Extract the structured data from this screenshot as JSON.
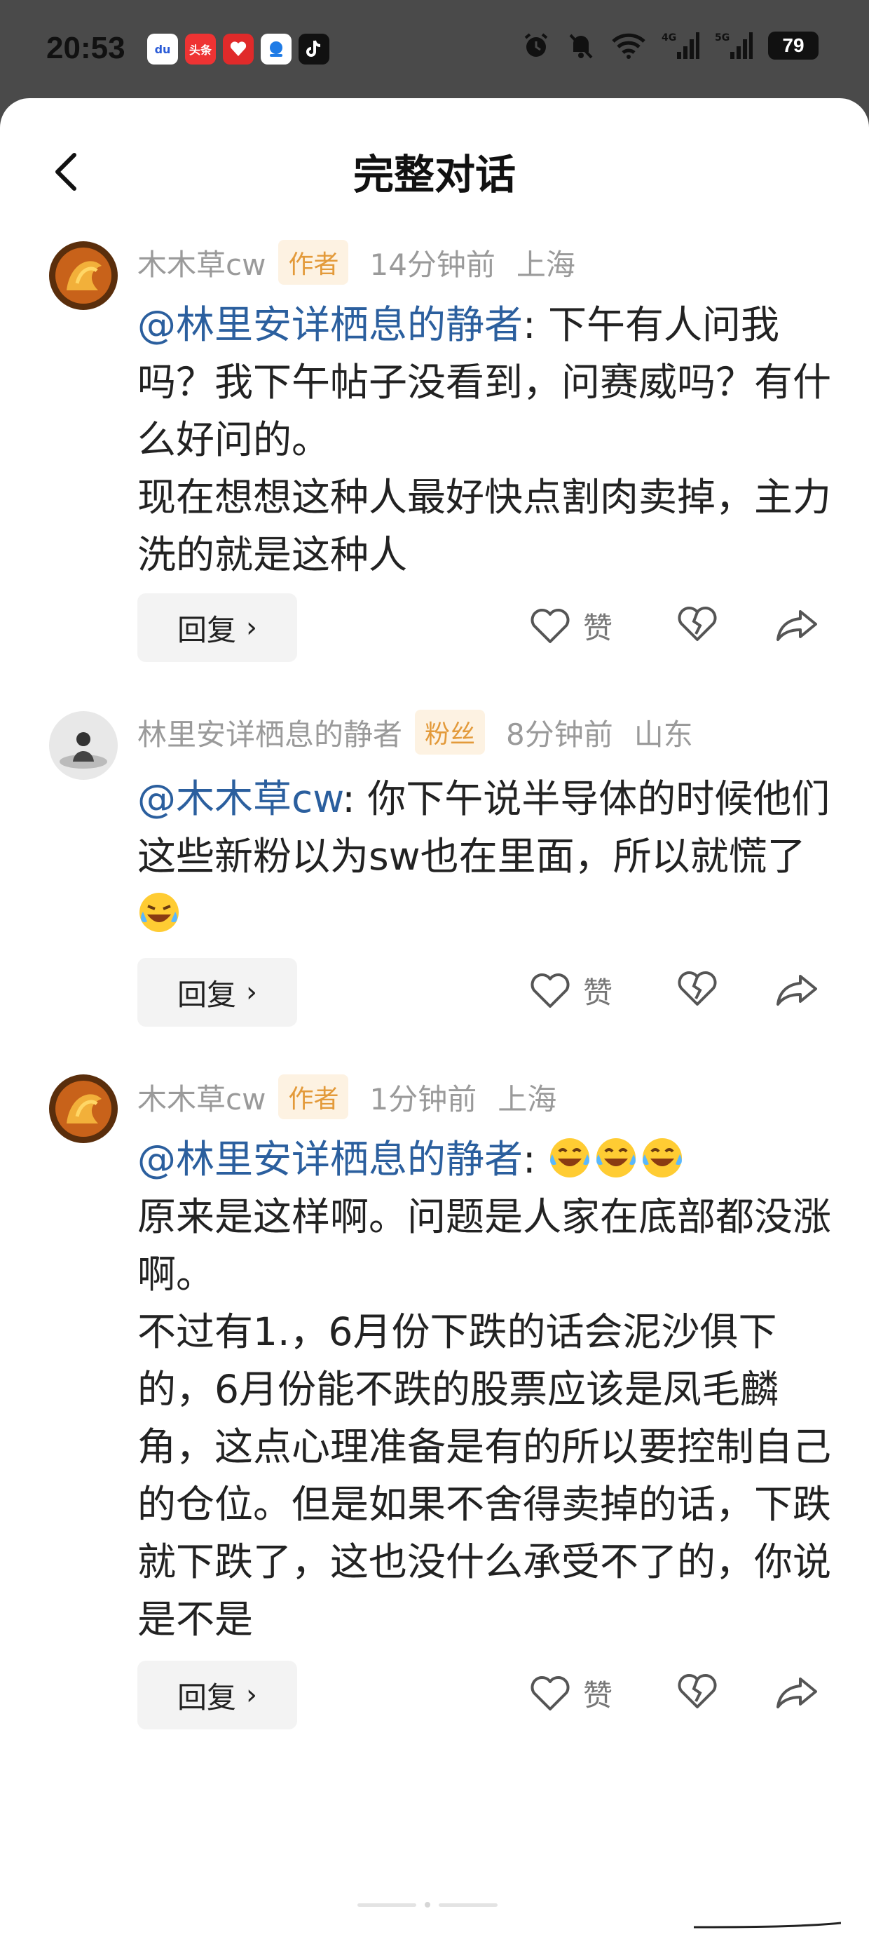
{
  "status_bar": {
    "time": "20:53",
    "battery": "79",
    "app_icons": [
      "baidu-icon",
      "toutiao-icon",
      "pinduoduo-icon",
      "browser-icon",
      "tiktok-icon"
    ],
    "app_labels": [
      "du",
      "头条",
      "",
      "",
      ""
    ],
    "signal": [
      "4G",
      "5G"
    ]
  },
  "nav": {
    "title": "完整对话"
  },
  "comments": [
    {
      "author": "木木草cw",
      "badge": "作者",
      "time": "14分钟前",
      "location": "上海",
      "mention": "@林里安详栖息的静者",
      "text": ": 下午有人问我吗？我下午帖子没看到，问赛威吗？有什么好问的。\n现在想想这种人最好快点割肉卖掉，主力洗的就是这种人",
      "reply_label": "回复",
      "like_label": "赞"
    },
    {
      "author": "林里安详栖息的静者",
      "badge": "粉丝",
      "time": "8分钟前",
      "location": "山东",
      "mention": "@木木草cw",
      "text": ": 你下午说半导体的时候他们这些新粉以为sw也在里面，所以就慌了",
      "reply_label": "回复",
      "like_label": "赞"
    },
    {
      "author": "木木草cw",
      "badge": "作者",
      "time": "1分钟前",
      "location": "上海",
      "mention": "@林里安详栖息的静者",
      "text": "原来是这样啊。问题是人家在底部都没涨啊。\n不过有1.，6月份下跌的话会泥沙俱下的，6月份能不跌的股票应该是凤毛麟角，这点心理准备是有的所以要控制自己的仓位。但是如果不舍得卖掉的话，下跌就下跌了，这也没什么承受不了的，你说是不是",
      "reply_label": "回复",
      "like_label": "赞"
    }
  ],
  "colors": {
    "mention": "#2b5f9e",
    "badge_bg": "#fdf2e2",
    "badge_text": "#e39a3a",
    "status_bar_bg": "#4a4a4a"
  }
}
